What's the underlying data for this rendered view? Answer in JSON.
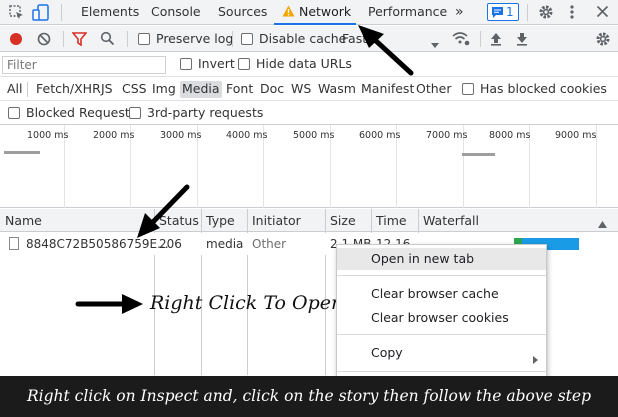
{
  "tabs": {
    "elements": "Elements",
    "console": "Console",
    "sources": "Sources",
    "network": "Network",
    "performance": "Performance",
    "more": "»",
    "message_count": "1"
  },
  "toolbar": {
    "preserve_log": "Preserve log",
    "disable_cache": "Disable cache",
    "throttling": "Fast"
  },
  "filter": {
    "placeholder": "Filter",
    "invert": "Invert",
    "hide_data_urls": "Hide data URLs"
  },
  "types": [
    "All",
    "Fetch/XHR",
    "JS",
    "CSS",
    "Img",
    "Media",
    "Font",
    "Doc",
    "WS",
    "Wasm",
    "Manifest",
    "Other"
  ],
  "selected_type": "Media",
  "has_blocked_cookies": "Has blocked cookies",
  "blocked_requests": "Blocked Requests",
  "third_party": "3rd-party requests",
  "timeline_ticks": [
    "1000 ms",
    "2000 ms",
    "3000 ms",
    "4000 ms",
    "5000 ms",
    "6000 ms",
    "7000 ms",
    "8000 ms",
    "9000 ms"
  ],
  "columns": {
    "name": "Name",
    "status": "Status",
    "type": "Type",
    "initiator": "Initiator",
    "size": "Size",
    "time": "Time",
    "waterfall": "Waterfall"
  },
  "row": {
    "name": "8848C72B50586759E...",
    "status": "206",
    "type": "media",
    "initiator": "Other",
    "size": "2.1 MB",
    "time": "12.16"
  },
  "context_menu": {
    "open_new_tab": "Open in new tab",
    "clear_cache": "Clear browser cache",
    "clear_cookies": "Clear browser cookies",
    "copy": "Copy"
  },
  "annotation": "Right Click To Open",
  "caption": "Right click on Inspect and, click on the story then follow the above step",
  "colors": {
    "accent": "#1a73e8",
    "record": "#d93025",
    "waterfall_bar": "#1a9be6",
    "warning": "#f2a600"
  }
}
